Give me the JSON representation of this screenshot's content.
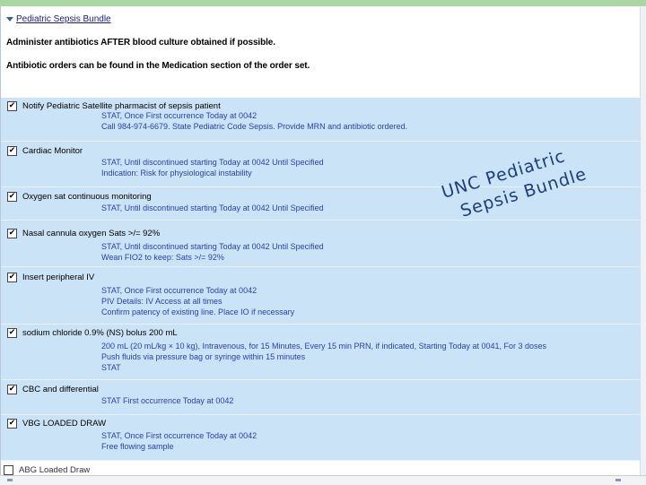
{
  "bundle": {
    "title": "Pediatric Sepsis Bundle",
    "notice_1": "Administer antibiotics AFTER blood culture obtained if possible.",
    "notice_2": "Antibiotic orders can be found in the Medication section of the order set."
  },
  "orders": [
    {
      "checked": true,
      "name": "Notify Pediatric Satellite pharmacist of sepsis patient",
      "details": [
        "STAT, Once First occurrence Today at 0042",
        "Call 984-974-6679. State Pediatric Code Sepsis. Provide MRN and antibiotic ordered."
      ]
    },
    {
      "checked": true,
      "name": "Cardiac Monitor",
      "details": [
        "STAT, Until discontinued starting Today at 0042 Until Specified",
        "Indication: Risk for physiological instability"
      ]
    },
    {
      "checked": true,
      "name": "Oxygen sat continuous monitoring",
      "details": [
        "STAT, Until discontinued starting Today at 0042 Until Specified"
      ]
    },
    {
      "checked": true,
      "name": "Nasal cannula oxygen Sats >/= 92%",
      "details": [
        "STAT, Until discontinued starting Today at 0042 Until Specified",
        "Wean FIO2 to keep: Sats >/= 92%"
      ]
    },
    {
      "checked": true,
      "name": "Insert peripheral IV",
      "details": [
        "STAT, Once First occurrence Today at 0042",
        "PIV Details: IV Access at all times",
        "Confirm patency of existing line.  Place IO if necessary"
      ]
    },
    {
      "checked": true,
      "name": "sodium chloride 0.9% (NS) bolus 200 mL",
      "details": [
        "200 mL (20 mL/kg × 10 kg), Intravenous, for 15 Minutes, Every 15 min PRN, if indicated, Starting Today at 0041, For 3 doses",
        "Push fluids via pressure bag or syringe within 15 minutes",
        "STAT"
      ]
    },
    {
      "checked": true,
      "name": "CBC and differential",
      "details": [
        "STAT First occurrence Today at 0042"
      ]
    },
    {
      "checked": true,
      "name": "VBG LOADED DRAW",
      "details": [
        "STAT, Once First occurrence Today at 0042",
        "Free flowing sample"
      ]
    },
    {
      "checked": false,
      "name": "ABG Loaded Draw",
      "details": []
    }
  ],
  "watermark": {
    "line1": "UNC Pediatric",
    "line2": "Sepsis Bundle"
  },
  "colors": {
    "list_background": "#cbe3f6",
    "detail_text": "#2a3fa8",
    "top_bar": "#a9d6a3"
  }
}
